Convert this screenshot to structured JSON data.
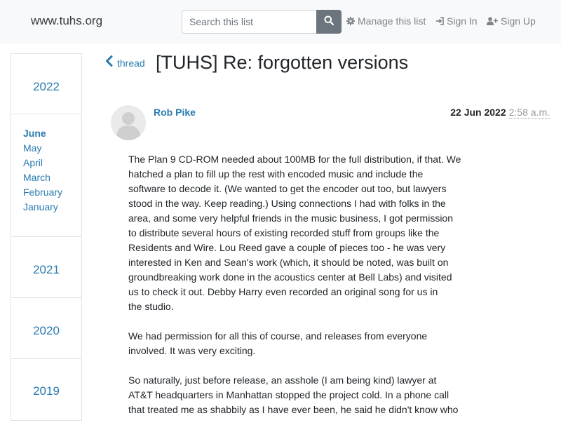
{
  "navbar": {
    "brand": "www.tuhs.org",
    "search_placeholder": "Search this list",
    "manage_label": "Manage this list",
    "signin_label": "Sign In",
    "signup_label": "Sign Up"
  },
  "sidebar": {
    "years": [
      {
        "label": "2022",
        "months": [
          "June",
          "May",
          "April",
          "March",
          "February",
          "January"
        ],
        "active_month": "June"
      },
      {
        "label": "2021"
      },
      {
        "label": "2020"
      },
      {
        "label": "2019"
      }
    ]
  },
  "header": {
    "thread_label": "thread",
    "title": "[TUHS] Re: forgotten versions"
  },
  "message": {
    "author": "Rob Pike",
    "date": "22 Jun 2022",
    "time": "2:58 a.m.",
    "paragraphs": [
      "The Plan 9 CD-ROM needed about 100MB for the full distribution, if that. We\nhatched a plan to fill up the rest with encoded music and include the\nsoftware to decode it. (We wanted to get the encoder out too, but lawyers\nstood in the way. Keep reading.) Using connections I had with folks in the\narea, and some very helpful friends in the music business, I got permission\nto distribute several hours of existing recorded stuff from groups like the\nResidents and Wire. Lou Reed gave a couple of pieces too - he was very\ninterested in Ken and Sean's work (which, it should be noted, was built on\ngroundbreaking work done in the acoustics center at Bell Labs) and visited\nus to check it out. Debby Harry even recorded an original song for us in\nthe studio.",
      "We had permission for all this of course, and releases from everyone\ninvolved. It was very exciting.",
      "So naturally, just before release, an asshole (I am being kind) lawyer at\nAT&T headquarters in Manhattan stopped the project cold. In a phone call\nthat treated me as shabbily as I have ever been, he said he didn't know who"
    ]
  },
  "colors": {
    "link": "#2a7ab0",
    "navbar_bg": "#f8f9fa",
    "search_button": "#6c757d"
  }
}
